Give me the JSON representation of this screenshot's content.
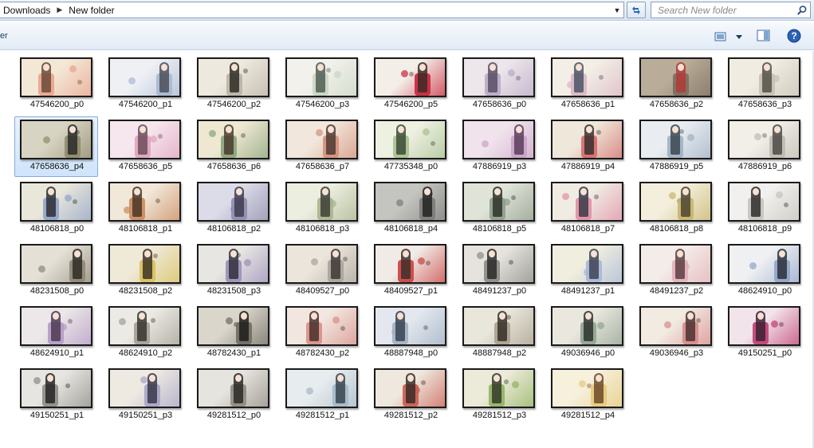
{
  "address": {
    "crumbs": [
      "Downloads",
      "New folder"
    ],
    "separator": "▶"
  },
  "search": {
    "placeholder": "Search New folder"
  },
  "toolbar": {
    "left_text": "er"
  },
  "files": [
    {
      "name": "47546200_p0",
      "palette": [
        "#f3e8d6",
        "#e9a38c",
        "#6b4a3a"
      ],
      "selected": false
    },
    {
      "name": "47546200_p1",
      "palette": [
        "#eef0f4",
        "#a9b8d2",
        "#4a4f5a"
      ],
      "selected": false
    },
    {
      "name": "47546200_p2",
      "palette": [
        "#eee9de",
        "#b9b3a5",
        "#2f2b26"
      ],
      "selected": false
    },
    {
      "name": "47546200_p3",
      "palette": [
        "#f2f1ec",
        "#c9d6c2",
        "#4f5d54"
      ],
      "selected": false
    },
    {
      "name": "47546200_p5",
      "palette": [
        "#f4eee8",
        "#c8253a",
        "#3b2a26"
      ],
      "selected": false
    },
    {
      "name": "47658636_p0",
      "palette": [
        "#ede6ea",
        "#b8aac6",
        "#5a4f66"
      ],
      "selected": false
    },
    {
      "name": "47658636_p1",
      "palette": [
        "#f3efe6",
        "#d9b6c4",
        "#4a5566"
      ],
      "selected": false
    },
    {
      "name": "47658636_p2",
      "palette": [
        "#b9ad9a",
        "#7c6e5d",
        "#b23a3a"
      ],
      "selected": false
    },
    {
      "name": "47658636_p3",
      "palette": [
        "#f1ece2",
        "#c7c1b3",
        "#55514a"
      ],
      "selected": false
    },
    {
      "name": "47658636_p4",
      "palette": [
        "#d8d4c3",
        "#8e8a6a",
        "#2a2a2a"
      ],
      "selected": true
    },
    {
      "name": "47658636_p5",
      "palette": [
        "#f6e7ee",
        "#e0a3bd",
        "#6b4d5a"
      ],
      "selected": false
    },
    {
      "name": "47658636_p6",
      "palette": [
        "#eee8d3",
        "#8aa27a",
        "#4a3b30"
      ],
      "selected": false
    },
    {
      "name": "47658636_p7",
      "palette": [
        "#f1e7dc",
        "#d4907a",
        "#4e3a32"
      ],
      "selected": false
    },
    {
      "name": "47735348_p0",
      "palette": [
        "#eef0e2",
        "#a6c08e",
        "#3c4a38"
      ],
      "selected": false
    },
    {
      "name": "47886919_p3",
      "palette": [
        "#f0e3ec",
        "#c9a3c7",
        "#5a3e5c"
      ],
      "selected": false
    },
    {
      "name": "47886919_p4",
      "palette": [
        "#efe7da",
        "#d36c6c",
        "#3a3030"
      ],
      "selected": false
    },
    {
      "name": "47886919_p5",
      "palette": [
        "#e9edf1",
        "#9eb1c2",
        "#3d4650"
      ],
      "selected": false
    },
    {
      "name": "47886919_p6",
      "palette": [
        "#f2efe9",
        "#bfbab0",
        "#4d4a46"
      ],
      "selected": false
    },
    {
      "name": "48106818_p0",
      "palette": [
        "#e9e6da",
        "#8fa3c9",
        "#2e2e33"
      ],
      "selected": false
    },
    {
      "name": "48106818_p1",
      "palette": [
        "#f2e8d9",
        "#c98a5e",
        "#4a3626"
      ],
      "selected": false
    },
    {
      "name": "48106818_p2",
      "palette": [
        "#dcdbe8",
        "#8d8cab",
        "#3f3b50"
      ],
      "selected": false
    },
    {
      "name": "48106818_p3",
      "palette": [
        "#eceee0",
        "#a9b48d",
        "#3d3d36"
      ],
      "selected": false
    },
    {
      "name": "48106818_p4",
      "palette": [
        "#c4c4c0",
        "#7b7b78",
        "#222222"
      ],
      "selected": false
    },
    {
      "name": "48106818_p5",
      "palette": [
        "#dfe3d8",
        "#8f9c8a",
        "#2d322c"
      ],
      "selected": false
    },
    {
      "name": "48106818_p7",
      "palette": [
        "#f0ece4",
        "#e08ea4",
        "#3a3a46"
      ],
      "selected": false
    },
    {
      "name": "48106818_p8",
      "palette": [
        "#f3efdc",
        "#c7b46d",
        "#4c4532"
      ],
      "selected": false
    },
    {
      "name": "48106818_p9",
      "palette": [
        "#f1f0ee",
        "#c5c3bd",
        "#2e2d2c"
      ],
      "selected": false
    },
    {
      "name": "48231508_p0",
      "palette": [
        "#e4e0d6",
        "#8e8776",
        "#2e2b26"
      ],
      "selected": false
    },
    {
      "name": "48231508_p2",
      "palette": [
        "#efe9d8",
        "#d8c05a",
        "#3b3426"
      ],
      "selected": false
    },
    {
      "name": "48231508_p3",
      "palette": [
        "#e8e6e2",
        "#9a8fb8",
        "#33303c"
      ],
      "selected": false
    },
    {
      "name": "48409527_p0",
      "palette": [
        "#ebe5dc",
        "#a9a39a",
        "#3d3833"
      ],
      "selected": false
    },
    {
      "name": "48409527_p1",
      "palette": [
        "#f1ebe7",
        "#c9413e",
        "#3f2f2a"
      ],
      "selected": false
    },
    {
      "name": "48491237_p0",
      "palette": [
        "#e6e3de",
        "#8a8a84",
        "#2a2a2a"
      ],
      "selected": false
    },
    {
      "name": "48491237_p1",
      "palette": [
        "#f0eedf",
        "#a7b7d8",
        "#3f4354"
      ],
      "selected": false
    },
    {
      "name": "48491237_p2",
      "palette": [
        "#f4ece8",
        "#e2b0b8",
        "#5b3f44"
      ],
      "selected": false
    },
    {
      "name": "48624910_p0",
      "palette": [
        "#eef0f2",
        "#8fa4c7",
        "#2c2f3a"
      ],
      "selected": false
    },
    {
      "name": "48624910_p1",
      "palette": [
        "#ece7e8",
        "#b49ac6",
        "#4e3a50"
      ],
      "selected": false
    },
    {
      "name": "48624910_p2",
      "palette": [
        "#eceae4",
        "#a29e94",
        "#38352f"
      ],
      "selected": false
    },
    {
      "name": "48782430_p1",
      "palette": [
        "#dad6cc",
        "#6e6a60",
        "#1e1d1b"
      ],
      "selected": false
    },
    {
      "name": "48782430_p2",
      "palette": [
        "#f2e6e0",
        "#d58f86",
        "#4a2f2a"
      ],
      "selected": false
    },
    {
      "name": "48887948_p0",
      "palette": [
        "#e4e8ee",
        "#9fb0c4",
        "#3a4250"
      ],
      "selected": false
    },
    {
      "name": "48887948_p2",
      "palette": [
        "#e9e6dc",
        "#a89f8c",
        "#362f28"
      ],
      "selected": false
    },
    {
      "name": "49036946_p0",
      "palette": [
        "#eae7de",
        "#8fa392",
        "#2d322e"
      ],
      "selected": false
    },
    {
      "name": "49036946_p3",
      "palette": [
        "#f1ebe2",
        "#d78a8a",
        "#4a3333"
      ],
      "selected": false
    },
    {
      "name": "49150251_p0",
      "palette": [
        "#f1e4ea",
        "#c23d72",
        "#3a2233"
      ],
      "selected": false
    },
    {
      "name": "49150251_p1",
      "palette": [
        "#e6e5e1",
        "#8d8b85",
        "#262524"
      ],
      "selected": false
    },
    {
      "name": "49150251_p3",
      "palette": [
        "#eeeae2",
        "#a7a3c6",
        "#3a384a"
      ],
      "selected": false
    },
    {
      "name": "49281512_p0",
      "palette": [
        "#e6e4de",
        "#8f8b82",
        "#2a2926"
      ],
      "selected": false
    },
    {
      "name": "49281512_p1",
      "palette": [
        "#e7ecef",
        "#a5b8c6",
        "#3a4550"
      ],
      "selected": false
    },
    {
      "name": "49281512_p2",
      "palette": [
        "#efe8de",
        "#c95c4f",
        "#3a2b28"
      ],
      "selected": false
    },
    {
      "name": "49281512_p3",
      "palette": [
        "#ecead8",
        "#8fb25f",
        "#36382a"
      ],
      "selected": false
    },
    {
      "name": "49281512_p4",
      "palette": [
        "#f6f0dc",
        "#e6c97a",
        "#6b4a2a"
      ],
      "selected": false
    }
  ]
}
